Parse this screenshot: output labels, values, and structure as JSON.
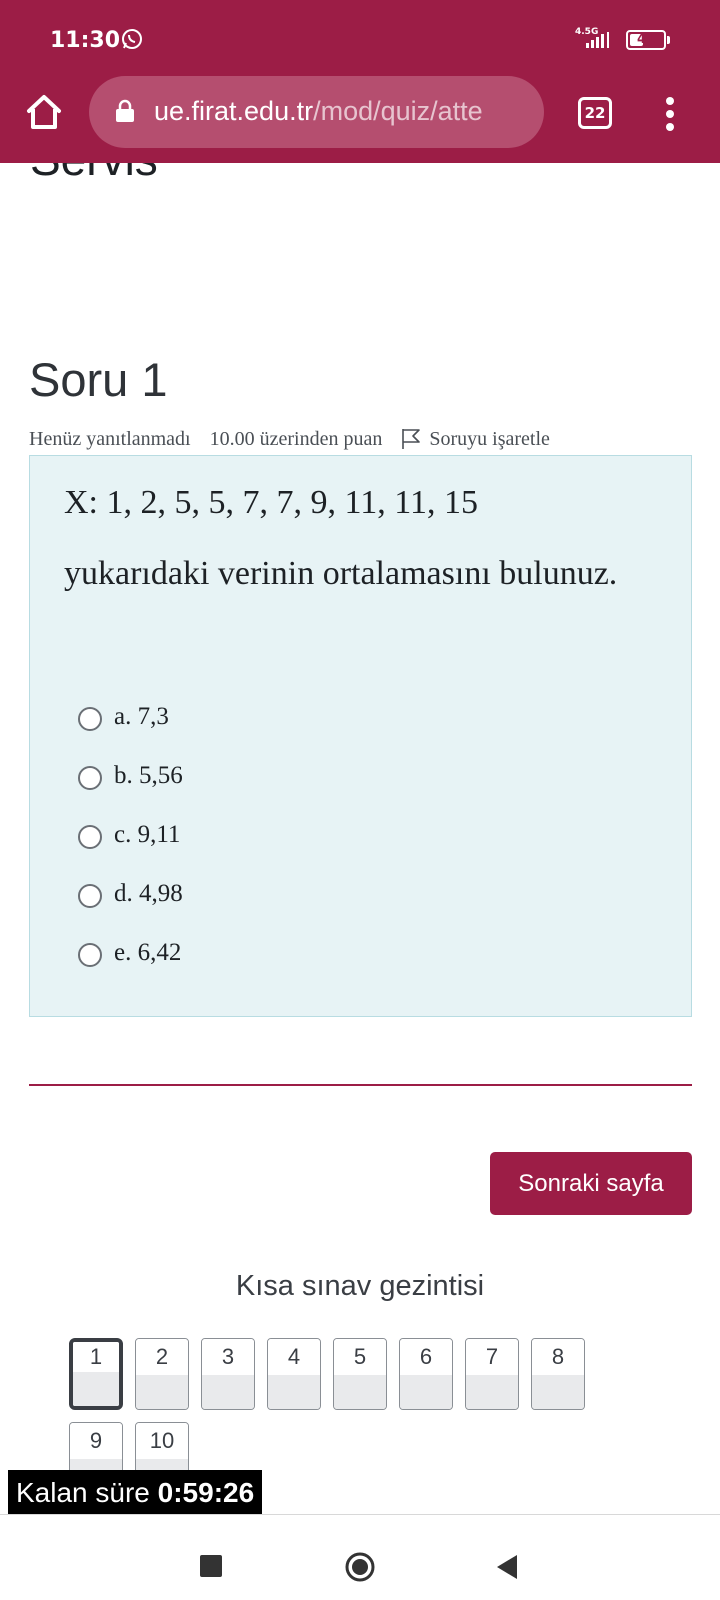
{
  "status_bar": {
    "time": "11:30",
    "network": "4.5G",
    "battery": "41",
    "battery_level": 0.41
  },
  "browser": {
    "url_host": "ue.firat.edu.tr",
    "url_path": "/mod/quiz/atte",
    "tab_count": "22"
  },
  "page": {
    "cut_heading": "Servis"
  },
  "question": {
    "number": "Soru 1",
    "state": "Henüz yanıtlanmadı",
    "grade": "10.00 üzerinden puan",
    "flag_label": "Soruyu işaretle",
    "data_line": "X: 1, 2, 5, 5, 7, 7, 9, 11, 11, 15",
    "prompt": "yukarıdaki verinin ortalamasını bulunuz.",
    "answers": [
      {
        "label": "a. 7,3"
      },
      {
        "label": "b. 5,56"
      },
      {
        "label": "c. 9,11"
      },
      {
        "label": "d. 4,98"
      },
      {
        "label": "e. 6,42"
      }
    ]
  },
  "next_button": "Sonraki sayfa",
  "quiz_nav": {
    "title": "Kısa sınav gezintisi",
    "current": "1",
    "items": [
      "1",
      "2",
      "3",
      "4",
      "5",
      "6",
      "7",
      "8",
      "9",
      "10"
    ]
  },
  "timer": {
    "label": "Kalan süre",
    "value": "0:59:26"
  },
  "colors": {
    "brand": "#9c1d46",
    "question_bg": "#e7f3f5"
  }
}
